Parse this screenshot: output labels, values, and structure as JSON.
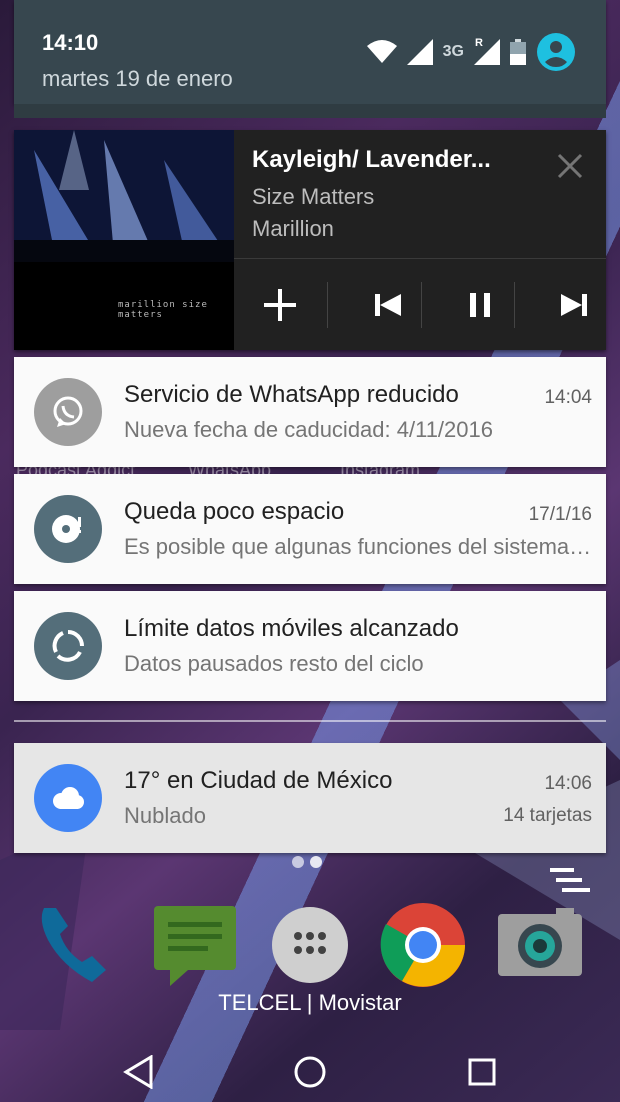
{
  "status": {
    "time": "14:10",
    "date": "martes 19 de enero",
    "network_type": "3G",
    "roaming_indicator": "R",
    "icons": [
      "wifi-icon",
      "signal-icon",
      "roaming-signal-icon",
      "battery-icon",
      "account-icon"
    ]
  },
  "media": {
    "title": "Kayleigh/ Lavender...",
    "album": "Size Matters",
    "artist": "Marillion",
    "album_art_caption": "marillion size matters",
    "controls": [
      "add-icon",
      "skip-previous-icon",
      "pause-icon",
      "skip-next-icon"
    ],
    "close_icon": "close-icon"
  },
  "notifications": [
    {
      "title": "Servicio de WhatsApp reducido",
      "text": "Nueva fecha de caducidad: 4/11/2016",
      "time": "14:04",
      "icon": "whatsapp-icon",
      "icon_color": "#9e9e9e"
    },
    {
      "title": "Queda poco espacio",
      "text": "Es posible que algunas funciones del sistema no funcionen",
      "time": "17/1/16",
      "icon": "storage-warning-icon",
      "icon_color": "#546e7a"
    },
    {
      "title": "Límite datos móviles alcanzado",
      "text": "Datos pausados resto del ciclo",
      "time": "",
      "icon": "data-usage-icon",
      "icon_color": "#546e7a"
    },
    {
      "title": "17° en Ciudad de México",
      "text": "Nublado",
      "time": "14:06",
      "extra": "14 tarjetas",
      "icon": "cloud-icon",
      "icon_color": "#4285f4"
    }
  ],
  "home": {
    "ghost_labels": [
      "Podcast Addict",
      "WhatsApp",
      "Instagram"
    ],
    "dock": [
      "phone-icon",
      "messaging-icon",
      "app-drawer-icon",
      "chrome-icon",
      "camera-icon"
    ],
    "carrier": "TELCEL | Movistar"
  },
  "navbar": [
    "back-icon",
    "home-icon",
    "recents-icon"
  ],
  "colors": {
    "header_bg": "#37474f",
    "media_bg": "#212121",
    "card_bg": "#fafafa",
    "accent_cyan": "#1ec0e0",
    "weather_blue": "#4285f4"
  }
}
